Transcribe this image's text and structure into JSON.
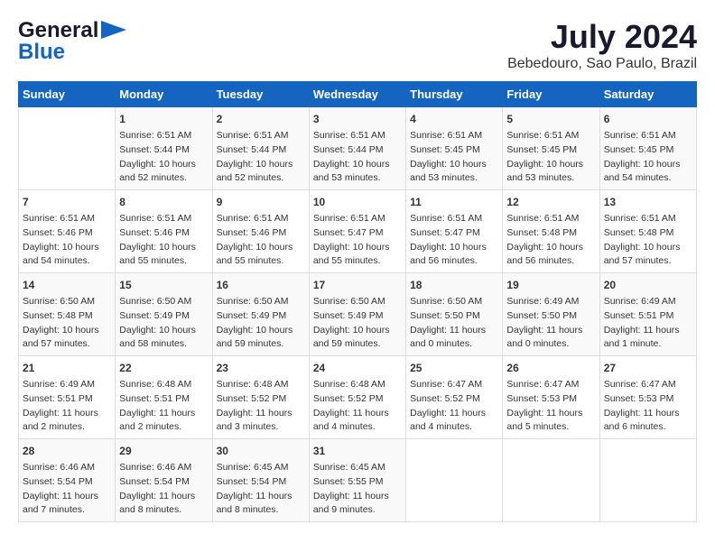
{
  "header": {
    "logo_general": "General",
    "logo_blue": "Blue",
    "month": "July 2024",
    "location": "Bebedouro, Sao Paulo, Brazil"
  },
  "weekdays": [
    "Sunday",
    "Monday",
    "Tuesday",
    "Wednesday",
    "Thursday",
    "Friday",
    "Saturday"
  ],
  "weeks": [
    [
      {
        "day": "",
        "lines": []
      },
      {
        "day": "1",
        "lines": [
          "Sunrise: 6:51 AM",
          "Sunset: 5:44 PM",
          "Daylight: 10 hours",
          "and 52 minutes."
        ]
      },
      {
        "day": "2",
        "lines": [
          "Sunrise: 6:51 AM",
          "Sunset: 5:44 PM",
          "Daylight: 10 hours",
          "and 52 minutes."
        ]
      },
      {
        "day": "3",
        "lines": [
          "Sunrise: 6:51 AM",
          "Sunset: 5:44 PM",
          "Daylight: 10 hours",
          "and 53 minutes."
        ]
      },
      {
        "day": "4",
        "lines": [
          "Sunrise: 6:51 AM",
          "Sunset: 5:45 PM",
          "Daylight: 10 hours",
          "and 53 minutes."
        ]
      },
      {
        "day": "5",
        "lines": [
          "Sunrise: 6:51 AM",
          "Sunset: 5:45 PM",
          "Daylight: 10 hours",
          "and 53 minutes."
        ]
      },
      {
        "day": "6",
        "lines": [
          "Sunrise: 6:51 AM",
          "Sunset: 5:45 PM",
          "Daylight: 10 hours",
          "and 54 minutes."
        ]
      }
    ],
    [
      {
        "day": "7",
        "lines": [
          "Sunrise: 6:51 AM",
          "Sunset: 5:46 PM",
          "Daylight: 10 hours",
          "and 54 minutes."
        ]
      },
      {
        "day": "8",
        "lines": [
          "Sunrise: 6:51 AM",
          "Sunset: 5:46 PM",
          "Daylight: 10 hours",
          "and 55 minutes."
        ]
      },
      {
        "day": "9",
        "lines": [
          "Sunrise: 6:51 AM",
          "Sunset: 5:46 PM",
          "Daylight: 10 hours",
          "and 55 minutes."
        ]
      },
      {
        "day": "10",
        "lines": [
          "Sunrise: 6:51 AM",
          "Sunset: 5:47 PM",
          "Daylight: 10 hours",
          "and 55 minutes."
        ]
      },
      {
        "day": "11",
        "lines": [
          "Sunrise: 6:51 AM",
          "Sunset: 5:47 PM",
          "Daylight: 10 hours",
          "and 56 minutes."
        ]
      },
      {
        "day": "12",
        "lines": [
          "Sunrise: 6:51 AM",
          "Sunset: 5:48 PM",
          "Daylight: 10 hours",
          "and 56 minutes."
        ]
      },
      {
        "day": "13",
        "lines": [
          "Sunrise: 6:51 AM",
          "Sunset: 5:48 PM",
          "Daylight: 10 hours",
          "and 57 minutes."
        ]
      }
    ],
    [
      {
        "day": "14",
        "lines": [
          "Sunrise: 6:50 AM",
          "Sunset: 5:48 PM",
          "Daylight: 10 hours",
          "and 57 minutes."
        ]
      },
      {
        "day": "15",
        "lines": [
          "Sunrise: 6:50 AM",
          "Sunset: 5:49 PM",
          "Daylight: 10 hours",
          "and 58 minutes."
        ]
      },
      {
        "day": "16",
        "lines": [
          "Sunrise: 6:50 AM",
          "Sunset: 5:49 PM",
          "Daylight: 10 hours",
          "and 59 minutes."
        ]
      },
      {
        "day": "17",
        "lines": [
          "Sunrise: 6:50 AM",
          "Sunset: 5:49 PM",
          "Daylight: 10 hours",
          "and 59 minutes."
        ]
      },
      {
        "day": "18",
        "lines": [
          "Sunrise: 6:50 AM",
          "Sunset: 5:50 PM",
          "Daylight: 11 hours",
          "and 0 minutes."
        ]
      },
      {
        "day": "19",
        "lines": [
          "Sunrise: 6:49 AM",
          "Sunset: 5:50 PM",
          "Daylight: 11 hours",
          "and 0 minutes."
        ]
      },
      {
        "day": "20",
        "lines": [
          "Sunrise: 6:49 AM",
          "Sunset: 5:51 PM",
          "Daylight: 11 hours",
          "and 1 minute."
        ]
      }
    ],
    [
      {
        "day": "21",
        "lines": [
          "Sunrise: 6:49 AM",
          "Sunset: 5:51 PM",
          "Daylight: 11 hours",
          "and 2 minutes."
        ]
      },
      {
        "day": "22",
        "lines": [
          "Sunrise: 6:48 AM",
          "Sunset: 5:51 PM",
          "Daylight: 11 hours",
          "and 2 minutes."
        ]
      },
      {
        "day": "23",
        "lines": [
          "Sunrise: 6:48 AM",
          "Sunset: 5:52 PM",
          "Daylight: 11 hours",
          "and 3 minutes."
        ]
      },
      {
        "day": "24",
        "lines": [
          "Sunrise: 6:48 AM",
          "Sunset: 5:52 PM",
          "Daylight: 11 hours",
          "and 4 minutes."
        ]
      },
      {
        "day": "25",
        "lines": [
          "Sunrise: 6:47 AM",
          "Sunset: 5:52 PM",
          "Daylight: 11 hours",
          "and 4 minutes."
        ]
      },
      {
        "day": "26",
        "lines": [
          "Sunrise: 6:47 AM",
          "Sunset: 5:53 PM",
          "Daylight: 11 hours",
          "and 5 minutes."
        ]
      },
      {
        "day": "27",
        "lines": [
          "Sunrise: 6:47 AM",
          "Sunset: 5:53 PM",
          "Daylight: 11 hours",
          "and 6 minutes."
        ]
      }
    ],
    [
      {
        "day": "28",
        "lines": [
          "Sunrise: 6:46 AM",
          "Sunset: 5:54 PM",
          "Daylight: 11 hours",
          "and 7 minutes."
        ]
      },
      {
        "day": "29",
        "lines": [
          "Sunrise: 6:46 AM",
          "Sunset: 5:54 PM",
          "Daylight: 11 hours",
          "and 8 minutes."
        ]
      },
      {
        "day": "30",
        "lines": [
          "Sunrise: 6:45 AM",
          "Sunset: 5:54 PM",
          "Daylight: 11 hours",
          "and 8 minutes."
        ]
      },
      {
        "day": "31",
        "lines": [
          "Sunrise: 6:45 AM",
          "Sunset: 5:55 PM",
          "Daylight: 11 hours",
          "and 9 minutes."
        ]
      },
      {
        "day": "",
        "lines": []
      },
      {
        "day": "",
        "lines": []
      },
      {
        "day": "",
        "lines": []
      }
    ]
  ]
}
